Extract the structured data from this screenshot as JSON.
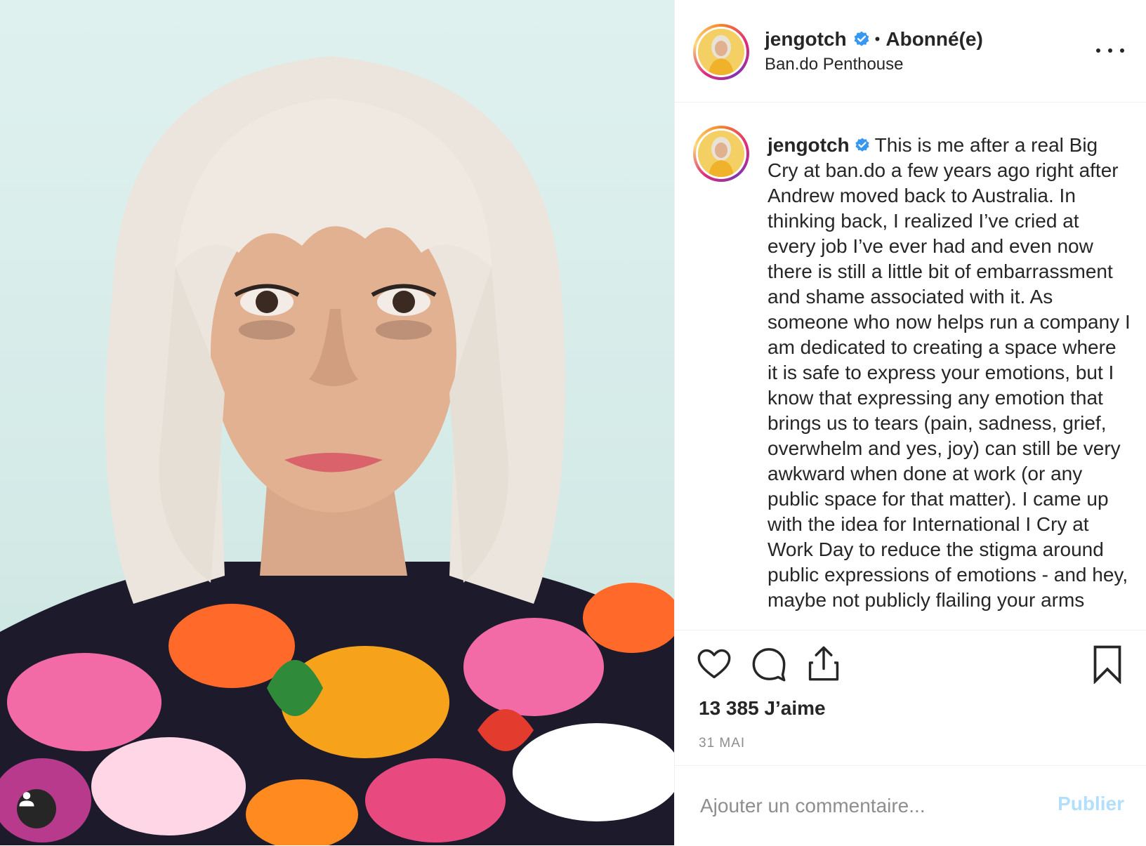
{
  "post": {
    "username": "jengotch",
    "follow_status": "Abonné(e)",
    "location": "Ban.do Penthouse",
    "caption": "This is me after a real Big Cry at ban.do a few years ago right after Andrew moved back to Australia. In thinking back, I realized I’ve cried at every job I’ve ever had and even now there is still a little bit of embarrassment and shame associated with it. As someone who now helps run a company I am dedicated to creating a space where it is safe to express your emotions, but I know that expressing any emotion that brings us to tears (pain, sadness, grief, overwhelm and yes, joy) can still be very awkward when done at work (or any public space for that matter). I came up with the idea for International I Cry at Work Day to reduce the stigma around public expressions of emotions - and hey, maybe not publicly flailing your arms",
    "likes": "13 385 J’aime",
    "date": "31 MAI"
  },
  "comment": {
    "placeholder": "Ajouter un commentaire...",
    "publish_label": "Publier"
  },
  "icons": {
    "verified": "verified-badge-icon",
    "more": "more-options-icon",
    "like": "heart-icon",
    "comment": "comment-bubble-icon",
    "share": "share-icon",
    "save": "bookmark-icon",
    "tagged": "tagged-user-icon"
  },
  "colors": {
    "verified_blue": "#3897f0",
    "publish_disabled": "#b2dffc",
    "text": "#262626",
    "muted": "#8e8e8e"
  }
}
